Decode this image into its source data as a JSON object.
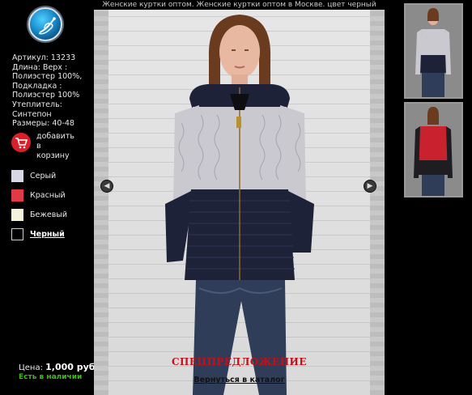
{
  "caption": "Женские куртки оптом. Женские куртки оптом в Москве. цвет черный",
  "product": {
    "article": "Артикул: 13233",
    "length": "Длина: Верх :\nПолиэстер 100%,\nПодкладка :\nПолиэстер 100%",
    "insulation": "Утеплитель:\nСинтепон",
    "sizes": "Размеры: 40-48"
  },
  "cart": {
    "label": "добавить\nв\nкорзину",
    "icon": "shopping-cart-icon"
  },
  "colors": [
    {
      "label": "Серый",
      "swatch": "#d8d7e6",
      "active": false
    },
    {
      "label": "Красный",
      "swatch": "#e23a44",
      "active": false
    },
    {
      "label": "Бежевый",
      "swatch": "#f4f2dc",
      "active": false
    },
    {
      "label": "Черный",
      "swatch": "#000000",
      "active": true
    }
  ],
  "price": {
    "label": "Цена:",
    "value": "1,000 руб."
  },
  "stock": "Есть в наличии",
  "viewer": {
    "special": "СПЕЦПРЕДЛОЖЕНИЕ",
    "back_link": "Вернуться в каталог",
    "prev_icon": "chevron-left-icon",
    "next_icon": "chevron-right-icon"
  },
  "palette": {
    "navy": "#1d2238",
    "knit_grey": "#c9c9cf",
    "red": "#c8222f",
    "jeans": "#2f3d58",
    "accent_green": "#3cbd16",
    "accent_red": "#c3101a"
  }
}
